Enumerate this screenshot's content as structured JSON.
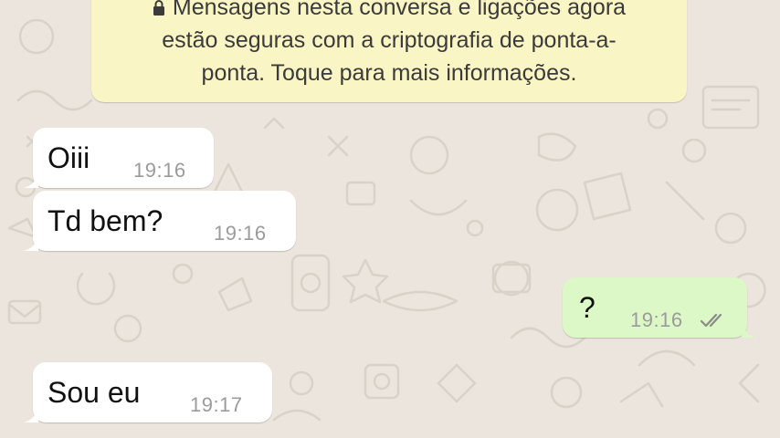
{
  "colors": {
    "wallpaper": "#ece5dd",
    "incoming_bubble": "#ffffff",
    "outgoing_bubble": "#dcf8c6",
    "encryption_notice": "#faf5c4",
    "timestamp": "#9b9b9b",
    "read_ticks": "#8a8a8a"
  },
  "notice": {
    "icon": "lock-icon",
    "line1": "Mensagens nesta conversa e ligações agora",
    "line2": "estão seguras com a criptografia de ponta-a-",
    "line3": "ponta. Toque para mais informações."
  },
  "messages": [
    {
      "direction": "incoming",
      "text": "Oiii",
      "time": "19:16"
    },
    {
      "direction": "incoming",
      "text": "Td bem?",
      "time": "19:16"
    },
    {
      "direction": "outgoing",
      "text": "?",
      "time": "19:16",
      "status_icon": "double-check-icon"
    },
    {
      "direction": "incoming",
      "text": "Sou eu",
      "time": "19:17"
    }
  ]
}
